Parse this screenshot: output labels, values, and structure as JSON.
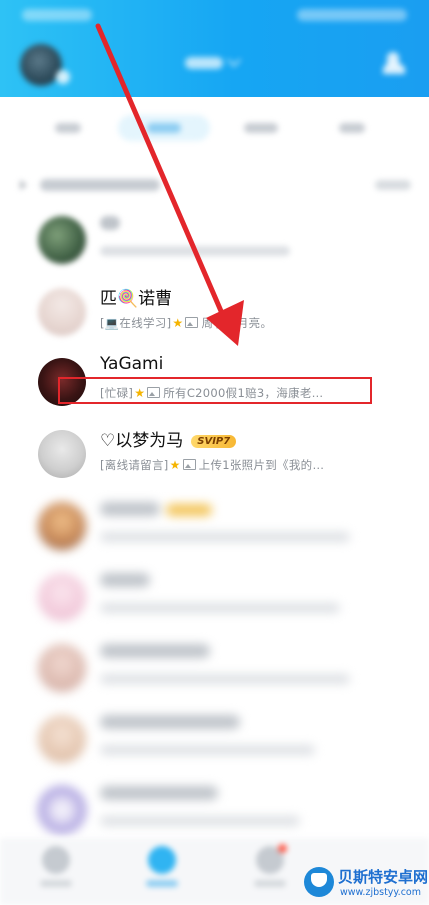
{
  "header": {
    "avatar_icon": "user-avatar",
    "dropdown_icon": "chevron-down-icon",
    "add_contact_icon": "add-friend-icon"
  },
  "tabs": [
    {
      "id": "tab-1",
      "active": false
    },
    {
      "id": "tab-2",
      "active": true
    },
    {
      "id": "tab-3",
      "active": false
    },
    {
      "id": "tab-4",
      "active": false
    }
  ],
  "contacts": [
    {
      "name": "",
      "message": "",
      "blurred": true
    },
    {
      "name": "匹🍭诺曹",
      "status": "[💻在线学习]",
      "message": "周了的月亮。",
      "blurred_partly": true
    },
    {
      "name": "YaGami",
      "status": "[忙碌]",
      "message": "所有C2000假1赔3，海康老…",
      "highlighted": true
    },
    {
      "name": "♡以梦为马",
      "badge": "SVIP7",
      "status": "[离线请留言]",
      "message": "上传1张照片到《我的…"
    },
    {
      "name": "",
      "message": "",
      "blurred": true
    },
    {
      "name": "",
      "message": "",
      "blurred": true
    },
    {
      "name": "",
      "message": "",
      "blurred": true
    },
    {
      "name": "",
      "message": "",
      "blurred": true
    },
    {
      "name": "",
      "message": "",
      "blurred": true
    }
  ],
  "annotation": {
    "color": "#e3262b"
  },
  "bottom_nav": [
    {
      "icon": "message-icon",
      "active": false
    },
    {
      "icon": "contacts-icon",
      "active": true
    },
    {
      "icon": "explore-icon",
      "active": false,
      "dot": true
    }
  ],
  "watermark": {
    "title": "贝斯特安卓网",
    "url": "www.zjbstyy.com"
  },
  "colors": {
    "header_blue": "#16a6f3",
    "accent": "#30b4f2",
    "svip_gold": "#f7b733",
    "highlight_red": "#e3262b"
  }
}
